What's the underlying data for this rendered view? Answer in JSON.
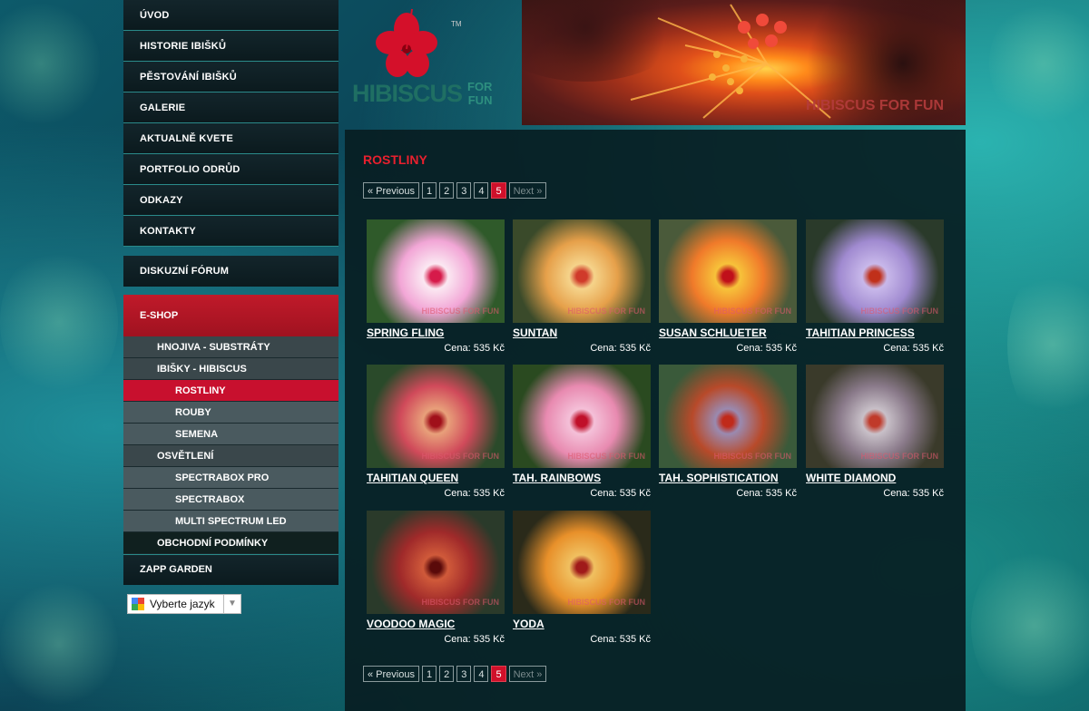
{
  "nav": {
    "items": [
      "ÚVOD",
      "HISTORIE IBIŠKŮ",
      "PĚSTOVÁNÍ IBIŠKŮ",
      "GALERIE",
      "AKTUALNĚ KVETE",
      "PORTFOLIO ODRŮD",
      "ODKAZY",
      "KONTAKTY"
    ],
    "forum": "DISKUZNÍ FÓRUM",
    "eshop": "E-SHOP",
    "sub": [
      {
        "label": "HNOJIVA - SUBSTRÁTY",
        "level": 1
      },
      {
        "label": "IBIŠKY - HIBISCUS",
        "level": 1
      },
      {
        "label": "ROSTLINY",
        "level": 2,
        "active": true
      },
      {
        "label": "ROUBY",
        "level": 2
      },
      {
        "label": "SEMENA",
        "level": 2
      },
      {
        "label": "OSVĚTLENÍ",
        "level": 1
      },
      {
        "label": "SPECTRABOX PRO",
        "level": 2
      },
      {
        "label": "SPECTRABOX",
        "level": 2
      },
      {
        "label": "MULTI SPECTRUM LED",
        "level": 2
      },
      {
        "label": "OBCHODNÍ PODMÍNKY",
        "level": 1,
        "dark": true
      }
    ],
    "zapp": "ZAPP GARDEN"
  },
  "language": {
    "label": "Vyberte jazyk",
    "arrow": "▼"
  },
  "logo": {
    "main": "HIBISCUS",
    "for": "FOR",
    "fun": "FUN",
    "tm": "TM"
  },
  "banner": {
    "watermark": "HIBISCUS FOR FUN"
  },
  "page": {
    "title": "ROSTLINY"
  },
  "pager": {
    "prev": "« Previous",
    "pages": [
      "1",
      "2",
      "3",
      "4",
      "5"
    ],
    "current": "5",
    "next": "Next »"
  },
  "products": [
    {
      "name": "SPRING FLING",
      "price": "Cena: 535 Kč",
      "c1": "#f2a6d6",
      "c2": "#fbe8f2",
      "c3": "#d61a4a",
      "bg": "#2f5a2a"
    },
    {
      "name": "SUNTAN",
      "price": "Cena: 535 Kč",
      "c1": "#e6a04a",
      "c2": "#f5d38a",
      "c3": "#d03a2a",
      "bg": "#3a4a2a"
    },
    {
      "name": "SUSAN SCHLUETER",
      "price": "Cena: 535 Kč",
      "c1": "#f07a2a",
      "c2": "#f7c23a",
      "c3": "#c0101a",
      "bg": "#4a5a3a"
    },
    {
      "name": "TAHITIAN PRINCESS",
      "price": "Cena: 535 Kč",
      "c1": "#a08ad0",
      "c2": "#c8b8ea",
      "c3": "#c0301a",
      "bg": "#2a3a2a"
    },
    {
      "name": "TAHITIAN QUEEN",
      "price": "Cena: 535 Kč",
      "c1": "#d04a5a",
      "c2": "#e8a07a",
      "c3": "#a0101a",
      "bg": "#2a4a2a"
    },
    {
      "name": "TAH. RAINBOWS",
      "price": "Cena: 535 Kč",
      "c1": "#e88ab0",
      "c2": "#f4c0d8",
      "c3": "#c0102a",
      "bg": "#2a4a20"
    },
    {
      "name": "TAH. SOPHISTICATION",
      "price": "Cena: 535 Kč",
      "c1": "#b84a2a",
      "c2": "#9a8ab0",
      "c3": "#c02a1a",
      "bg": "#3a5a3a"
    },
    {
      "name": "WHITE DIAMOND",
      "price": "Cena: 535 Kč",
      "c1": "#8a7a8a",
      "c2": "#c8c0c8",
      "c3": "#c03a2a",
      "bg": "#3a3a2a"
    },
    {
      "name": "VOODOO MAGIC",
      "price": "Cena: 535 Kč",
      "c1": "#a02a2a",
      "c2": "#d05a3a",
      "c3": "#5a0a0a",
      "bg": "#2a3a2a"
    },
    {
      "name": "YODA",
      "price": "Cena: 535 Kč",
      "c1": "#e8902a",
      "c2": "#f0c060",
      "c3": "#a01a1a",
      "bg": "#2a2a1a"
    }
  ],
  "watermark": "HIBISCUS FOR FUN"
}
